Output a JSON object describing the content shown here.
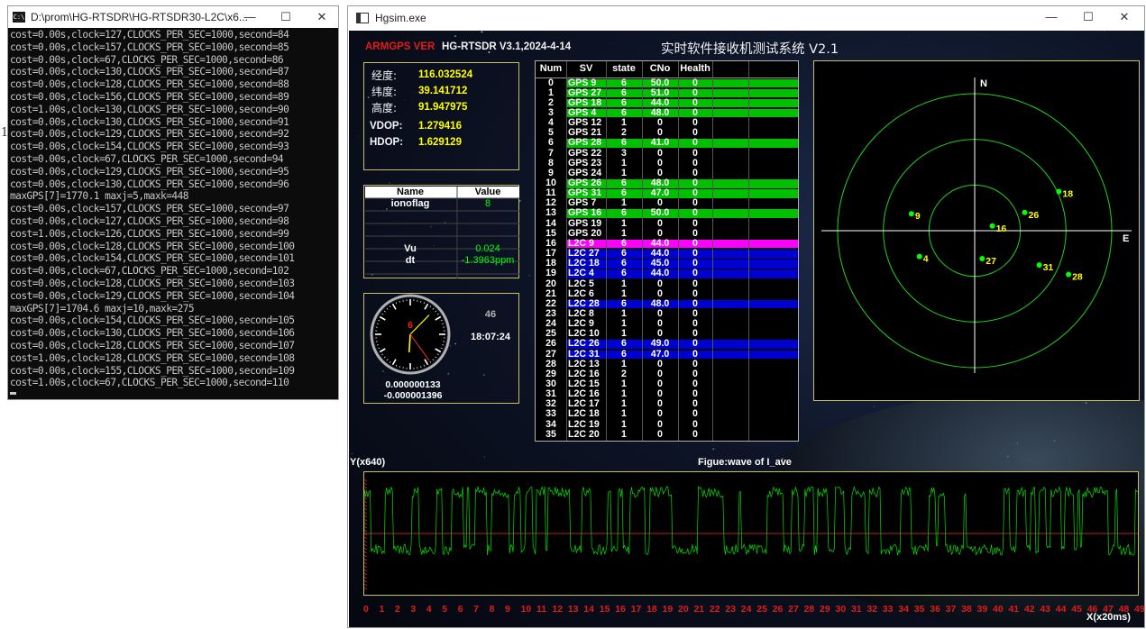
{
  "console": {
    "title": "D:\\prom\\HG-RTSDR\\HG-RTSDR30-L2C\\x6...",
    "lines": [
      "cost=0.00s,clock=127,CLOCKS_PER_SEC=1000,second=84",
      "cost=0.00s,clock=157,CLOCKS_PER_SEC=1000,second=85",
      "cost=0.00s,clock=67,CLOCKS_PER_SEC=1000,second=86",
      "cost=0.00s,clock=130,CLOCKS_PER_SEC=1000,second=87",
      "cost=0.00s,clock=128,CLOCKS_PER_SEC=1000,second=88",
      "cost=0.00s,clock=156,CLOCKS_PER_SEC=1000,second=89",
      "cost=1.00s,clock=130,CLOCKS_PER_SEC=1000,second=90",
      "cost=0.00s,clock=130,CLOCKS_PER_SEC=1000,second=91",
      "cost=0.00s,clock=129,CLOCKS_PER_SEC=1000,second=92",
      "cost=0.00s,clock=154,CLOCKS_PER_SEC=1000,second=93",
      "cost=0.00s,clock=67,CLOCKS_PER_SEC=1000,second=94",
      "cost=0.00s,clock=129,CLOCKS_PER_SEC=1000,second=95",
      "cost=0.00s,clock=130,CLOCKS_PER_SEC=1000,second=96",
      "maxGPS[7]=1770.1 maxj=5,maxk=448",
      "cost=0.00s,clock=157,CLOCKS_PER_SEC=1000,second=97",
      "cost=0.00s,clock=127,CLOCKS_PER_SEC=1000,second=98",
      "cost=1.00s,clock=126,CLOCKS_PER_SEC=1000,second=99",
      "cost=0.00s,clock=128,CLOCKS_PER_SEC=1000,second=100",
      "cost=0.00s,clock=154,CLOCKS_PER_SEC=1000,second=101",
      "cost=0.00s,clock=67,CLOCKS_PER_SEC=1000,second=102",
      "cost=0.00s,clock=128,CLOCKS_PER_SEC=1000,second=103",
      "cost=0.00s,clock=129,CLOCKS_PER_SEC=1000,second=104",
      "maxGPS[7]=1704.6 maxj=10,maxk=275",
      "cost=0.00s,clock=154,CLOCKS_PER_SEC=1000,second=105",
      "cost=0.00s,clock=130,CLOCKS_PER_SEC=1000,second=106",
      "cost=0.00s,clock=128,CLOCKS_PER_SEC=1000,second=107",
      "cost=1.00s,clock=128,CLOCKS_PER_SEC=1000,second=108",
      "cost=0.00s,clock=155,CLOCKS_PER_SEC=1000,second=109",
      "cost=1.00s,clock=67,CLOCKS_PER_SEC=1000,second=110"
    ]
  },
  "stray_char": "1",
  "window_controls": {
    "minimize": "—",
    "maximize": "☐",
    "close": "✕"
  },
  "hgsim": {
    "title": "Hgsim.exe",
    "brand_red": "ARMGPS VER",
    "brand_version": "HG-RTSDR V3.1,2024-4-14",
    "system_title": "实时软件接收机测试系统 V2.1",
    "position": {
      "lon_label": "经度:",
      "lon": "116.032524",
      "lat_label": "纬度:",
      "lat": "39.141712",
      "alt_label": "高度:",
      "alt": "91.947975",
      "vdop_label": "VDOP:",
      "vdop": "1.279416",
      "hdop_label": "HDOP:",
      "hdop": "1.629129"
    },
    "params": {
      "header_name": "Name",
      "header_value": "Value",
      "rows": [
        {
          "name": "ionoflag",
          "value": "8"
        },
        {
          "name": "",
          "value": ""
        },
        {
          "name": "",
          "value": ""
        },
        {
          "name": "",
          "value": ""
        },
        {
          "name": "Vu",
          "value": "0.024"
        },
        {
          "name": "dt",
          "value": "-1.3963ppm"
        }
      ]
    },
    "clock": {
      "hour_mark": "6",
      "seconds": "46",
      "time": "18:07:24",
      "val1": "0.000000133",
      "val2": "-0.000001396",
      "hands": {
        "hour": 18.12,
        "minute": 7.4,
        "second": 24
      }
    },
    "table": {
      "headers": [
        "Num",
        "SV",
        "state",
        "CNo",
        "Health"
      ],
      "highlight_colors": {
        "green": "#00c000",
        "magenta": "#ff00ff",
        "blue": "#0000d0"
      },
      "rows": [
        {
          "num": "0",
          "sv": "GPS 9",
          "state": "6",
          "cno": "50.0",
          "health": "0",
          "hl": "green"
        },
        {
          "num": "1",
          "sv": "GPS 27",
          "state": "6",
          "cno": "51.0",
          "health": "0",
          "hl": "green"
        },
        {
          "num": "2",
          "sv": "GPS 18",
          "state": "6",
          "cno": "44.0",
          "health": "0",
          "hl": "green"
        },
        {
          "num": "3",
          "sv": "GPS 4",
          "state": "6",
          "cno": "48.0",
          "health": "0",
          "hl": "green"
        },
        {
          "num": "4",
          "sv": "GPS 12",
          "state": "1",
          "cno": "0",
          "health": "0",
          "hl": ""
        },
        {
          "num": "5",
          "sv": "GPS 21",
          "state": "2",
          "cno": "0",
          "health": "0",
          "hl": ""
        },
        {
          "num": "6",
          "sv": "GPS 28",
          "state": "6",
          "cno": "41.0",
          "health": "0",
          "hl": "green"
        },
        {
          "num": "7",
          "sv": "GPS 22",
          "state": "3",
          "cno": "0",
          "health": "0",
          "hl": ""
        },
        {
          "num": "8",
          "sv": "GPS 23",
          "state": "1",
          "cno": "0",
          "health": "0",
          "hl": ""
        },
        {
          "num": "9",
          "sv": "GPS 24",
          "state": "1",
          "cno": "0",
          "health": "0",
          "hl": ""
        },
        {
          "num": "10",
          "sv": "GPS 26",
          "state": "6",
          "cno": "48.0",
          "health": "0",
          "hl": "green"
        },
        {
          "num": "11",
          "sv": "GPS 31",
          "state": "6",
          "cno": "47.0",
          "health": "0",
          "hl": "green"
        },
        {
          "num": "12",
          "sv": "GPS 7",
          "state": "1",
          "cno": "0",
          "health": "0",
          "hl": ""
        },
        {
          "num": "13",
          "sv": "GPS 16",
          "state": "6",
          "cno": "50.0",
          "health": "0",
          "hl": "green"
        },
        {
          "num": "14",
          "sv": "GPS 19",
          "state": "1",
          "cno": "0",
          "health": "0",
          "hl": ""
        },
        {
          "num": "15",
          "sv": "GPS 20",
          "state": "1",
          "cno": "0",
          "health": "0",
          "hl": ""
        },
        {
          "num": "16",
          "sv": "L2C 9",
          "state": "6",
          "cno": "44.0",
          "health": "0",
          "hl": "magenta"
        },
        {
          "num": "17",
          "sv": "L2C 27",
          "state": "6",
          "cno": "44.0",
          "health": "0",
          "hl": "blue"
        },
        {
          "num": "18",
          "sv": "L2C 18",
          "state": "6",
          "cno": "45.0",
          "health": "0",
          "hl": "blue"
        },
        {
          "num": "19",
          "sv": "L2C 4",
          "state": "6",
          "cno": "44.0",
          "health": "0",
          "hl": "blue"
        },
        {
          "num": "20",
          "sv": "L2C 5",
          "state": "1",
          "cno": "0",
          "health": "0",
          "hl": ""
        },
        {
          "num": "21",
          "sv": "L2C 6",
          "state": "1",
          "cno": "0",
          "health": "0",
          "hl": ""
        },
        {
          "num": "22",
          "sv": "L2C 28",
          "state": "6",
          "cno": "48.0",
          "health": "0",
          "hl": "blue"
        },
        {
          "num": "23",
          "sv": "L2C 8",
          "state": "1",
          "cno": "0",
          "health": "0",
          "hl": ""
        },
        {
          "num": "24",
          "sv": "L2C 9",
          "state": "1",
          "cno": "0",
          "health": "0",
          "hl": ""
        },
        {
          "num": "25",
          "sv": "L2C 10",
          "state": "1",
          "cno": "0",
          "health": "0",
          "hl": ""
        },
        {
          "num": "26",
          "sv": "L2C 26",
          "state": "6",
          "cno": "49.0",
          "health": "0",
          "hl": "blue"
        },
        {
          "num": "27",
          "sv": "L2C 31",
          "state": "6",
          "cno": "47.0",
          "health": "0",
          "hl": "blue"
        },
        {
          "num": "28",
          "sv": "L2C 13",
          "state": "1",
          "cno": "0",
          "health": "0",
          "hl": ""
        },
        {
          "num": "29",
          "sv": "L2C 16",
          "state": "2",
          "cno": "0",
          "health": "0",
          "hl": ""
        },
        {
          "num": "30",
          "sv": "L2C 15",
          "state": "1",
          "cno": "0",
          "health": "0",
          "hl": ""
        },
        {
          "num": "31",
          "sv": "L2C 16",
          "state": "1",
          "cno": "0",
          "health": "0",
          "hl": ""
        },
        {
          "num": "32",
          "sv": "L2C 17",
          "state": "1",
          "cno": "0",
          "health": "0",
          "hl": ""
        },
        {
          "num": "33",
          "sv": "L2C 18",
          "state": "1",
          "cno": "0",
          "health": "0",
          "hl": ""
        },
        {
          "num": "34",
          "sv": "L2C 19",
          "state": "1",
          "cno": "0",
          "health": "0",
          "hl": ""
        },
        {
          "num": "35",
          "sv": "L2C 20",
          "state": "1",
          "cno": "0",
          "health": "0",
          "hl": ""
        }
      ]
    },
    "skyplot": {
      "north_label": "N",
      "east_label": "E",
      "satellites": [
        {
          "prn": "9",
          "az": 285,
          "el": 47
        },
        {
          "prn": "16",
          "az": 75,
          "el": 78
        },
        {
          "prn": "26",
          "az": 70,
          "el": 55
        },
        {
          "prn": "18",
          "az": 65,
          "el": 29
        },
        {
          "prn": "4",
          "az": 245,
          "el": 50
        },
        {
          "prn": "27",
          "az": 165,
          "el": 71
        },
        {
          "prn": "31",
          "az": 118,
          "el": 42
        },
        {
          "prn": "28",
          "az": 115,
          "el": 22
        }
      ]
    },
    "wave": {
      "ylabel": "Y(x640)",
      "title": "Figue:wave of I_ave",
      "xlabel": "X(x20ms)",
      "xticks": [
        "0",
        "1",
        "2",
        "3",
        "4",
        "5",
        "6",
        "7",
        "8",
        "9",
        "10",
        "11",
        "12",
        "13",
        "14",
        "15",
        "16",
        "17",
        "18",
        "19",
        "20",
        "21",
        "22",
        "23",
        "24",
        "25",
        "26",
        "27",
        "28",
        "29",
        "30",
        "31",
        "32",
        "33",
        "34",
        "35",
        "36",
        "37",
        "38",
        "39",
        "40",
        "41",
        "42",
        "43",
        "44",
        "45",
        "46",
        "47",
        "48",
        "49"
      ]
    }
  }
}
